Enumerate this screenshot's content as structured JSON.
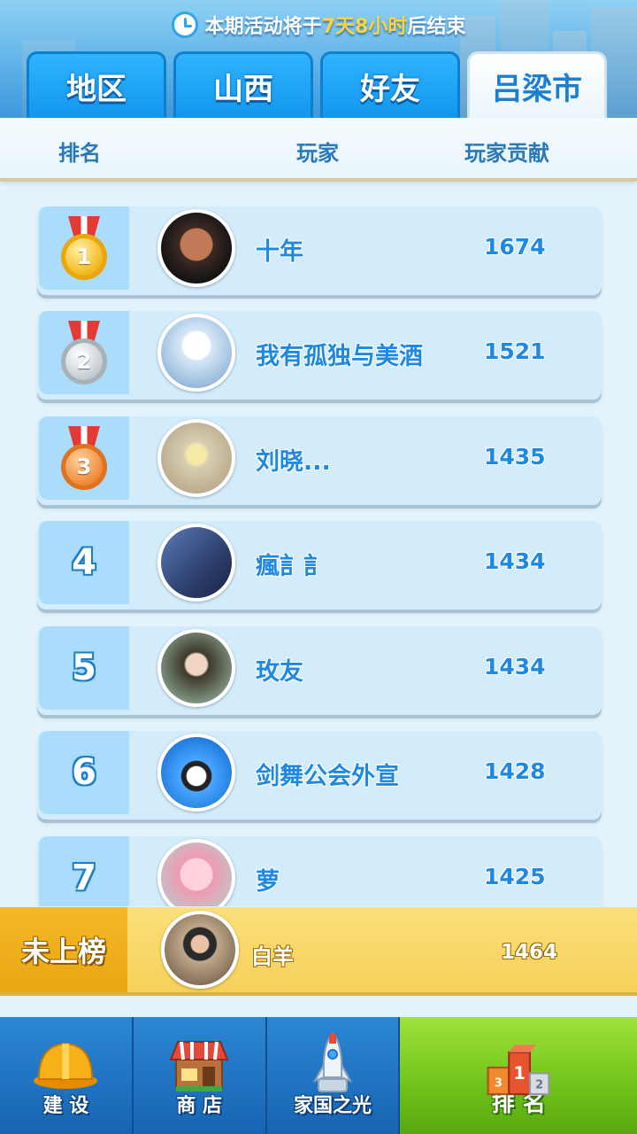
{
  "timer": {
    "prefix": "本期活动将于",
    "remaining": "7天8小时",
    "suffix": "后结束"
  },
  "tabs": [
    {
      "label": "地区",
      "active": false
    },
    {
      "label": "山西",
      "active": false
    },
    {
      "label": "好友",
      "active": false
    },
    {
      "label": "吕梁市",
      "active": true
    }
  ],
  "columns": {
    "rank": "排名",
    "player": "玩家",
    "contribution": "玩家贡献"
  },
  "rows": [
    {
      "rank": "1",
      "name": "十年",
      "score": "1674",
      "medal": "gold"
    },
    {
      "rank": "2",
      "name": "我有孤独与美酒",
      "score": "1521",
      "medal": "silver"
    },
    {
      "rank": "3",
      "name": "刘晓...",
      "score": "1435",
      "medal": "bronze"
    },
    {
      "rank": "4",
      "name": "瘋訁訁",
      "score": "1434"
    },
    {
      "rank": "5",
      "name": "玫友",
      "score": "1434"
    },
    {
      "rank": "6",
      "name": "剑舞公会外宣",
      "score": "1428"
    },
    {
      "rank": "7",
      "name": "萝",
      "score": "1425"
    }
  ],
  "me": {
    "status": "未上榜",
    "name": "白羊",
    "score": "1464"
  },
  "nav": [
    {
      "label": "建 设",
      "icon": "hardhat-icon",
      "active": false
    },
    {
      "label": "商 店",
      "icon": "shop-icon",
      "active": false
    },
    {
      "label": "家国之光",
      "icon": "rocket-icon",
      "active": false
    },
    {
      "label": "排 名",
      "icon": "podium-icon",
      "active": true
    }
  ],
  "colors": {
    "accent": "#1f88e0",
    "highlight": "#ffd43a",
    "active_nav": "#6fc21a",
    "my_bar": "#f6d05a"
  }
}
